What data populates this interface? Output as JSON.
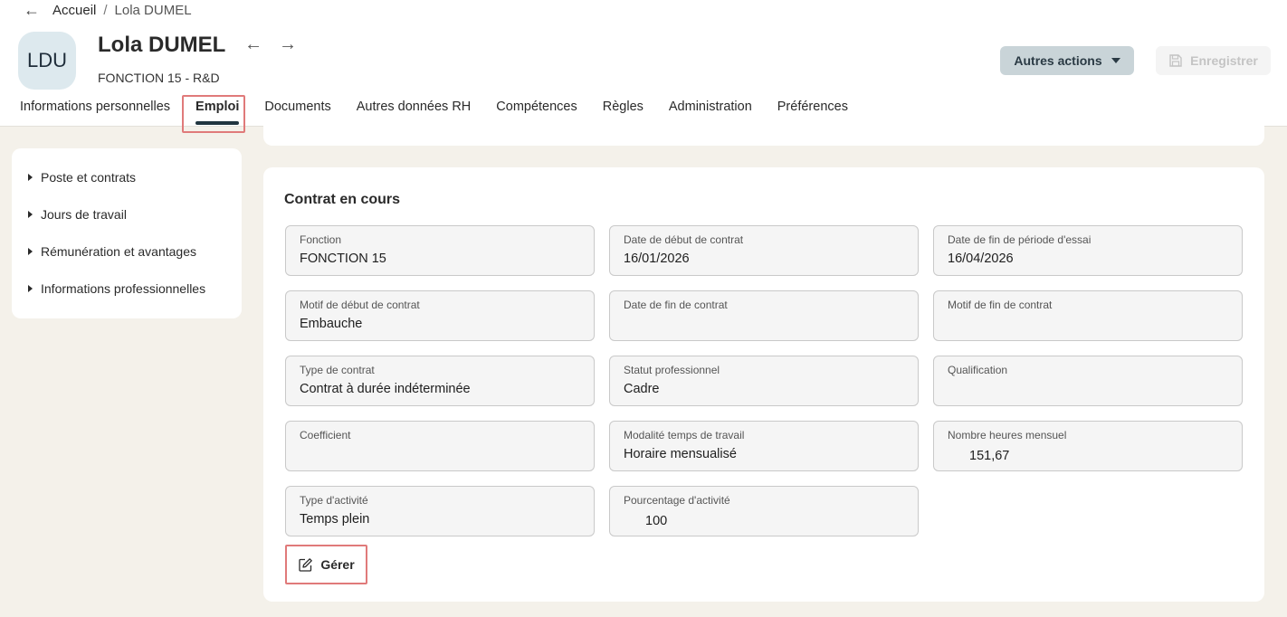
{
  "breadcrumb": {
    "back_icon": "←",
    "home": "Accueil",
    "separator": "/",
    "current": "Lola DUMEL"
  },
  "employee": {
    "initials": "LDU",
    "name": "Lola DUMEL",
    "subtitle": "FONCTION 15 - R&D",
    "prev_icon": "←",
    "next_icon": "→"
  },
  "actions": {
    "more_label": "Autres actions",
    "save_label": "Enregistrer"
  },
  "tabs": [
    {
      "label": "Informations personnelles"
    },
    {
      "label": "Emploi",
      "active": true
    },
    {
      "label": "Documents"
    },
    {
      "label": "Autres données RH"
    },
    {
      "label": "Compétences"
    },
    {
      "label": "Règles"
    },
    {
      "label": "Administration"
    },
    {
      "label": "Préférences"
    }
  ],
  "sidebar": {
    "items": [
      {
        "label": "Poste et contrats"
      },
      {
        "label": "Jours de travail"
      },
      {
        "label": "Rémunération et avantages"
      },
      {
        "label": "Informations professionnelles"
      }
    ]
  },
  "contract": {
    "title": "Contrat en cours",
    "fields": [
      {
        "label": "Fonction",
        "value": "FONCTION 15"
      },
      {
        "label": "Date de début de contrat",
        "value": "16/01/2026"
      },
      {
        "label": "Date de fin de période d'essai",
        "value": "16/04/2026"
      },
      {
        "label": "Motif de début de contrat",
        "value": "Embauche"
      },
      {
        "label": "Date de fin de contrat",
        "value": ""
      },
      {
        "label": "Motif de fin de contrat",
        "value": ""
      },
      {
        "label": "Type de contrat",
        "value": "Contrat à durée indéterminée"
      },
      {
        "label": "Statut professionnel",
        "value": "Cadre"
      },
      {
        "label": "Qualification",
        "value": ""
      },
      {
        "label": "Coefficient",
        "value": ""
      },
      {
        "label": "Modalité temps de travail",
        "value": "Horaire mensualisé"
      },
      {
        "label": "Nombre heures mensuel",
        "value": "151,67"
      },
      {
        "label": "Type d'activité",
        "value": "Temps plein"
      },
      {
        "label": "Pourcentage d'activité",
        "value": "100"
      }
    ],
    "manage_label": "Gérer"
  },
  "colors": {
    "accent_dark": "#213540",
    "highlight": "#e07a7a",
    "background": "#f4f1ea"
  }
}
